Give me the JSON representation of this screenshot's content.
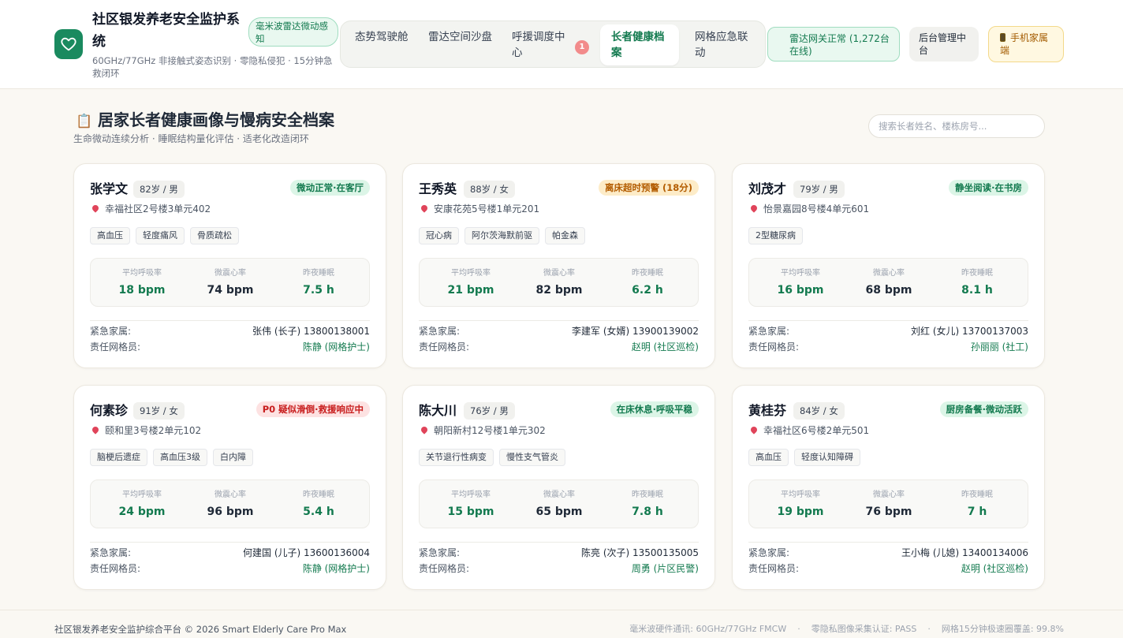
{
  "app": {
    "title": "社区银发养老安全监护系统",
    "subtitle": "60GHz/77GHz 非接触式姿态识别 · 零隐私侵犯 · 15分钟急救闭环",
    "radar_badge": "毫米波雷达微动感知"
  },
  "nav": {
    "tabs": [
      {
        "label": "态势驾驶舱"
      },
      {
        "label": "雷达空间沙盘"
      },
      {
        "label": "呼援调度中心",
        "badge": "1"
      },
      {
        "label": "长者健康档案",
        "active": true
      },
      {
        "label": "网格应急联动"
      }
    ]
  },
  "header_actions": {
    "gateway_status": "雷达网关正常 (1,272台在线)",
    "admin_label": "后台管理中台",
    "mobile_label": "手机家属端",
    "mobile_icon": "phone-icon"
  },
  "page": {
    "title": "居家长者健康画像与慢病安全档案",
    "title_icon": "clipboard-icon",
    "subtitle": "生命微动连续分析 · 睡眠结构量化评估 · 适老化改造闭环",
    "search_placeholder": "搜索长者姓名、楼栋房号..."
  },
  "labels": {
    "respiration": "平均呼吸率",
    "heart_rate": "微震心率",
    "sleep": "昨夜睡眠",
    "family": "紧急家属:",
    "grid_worker": "责任网格员:"
  },
  "colors": {
    "brand": "#1a8a5f",
    "status_green": "#137a4f",
    "status_amber": "#b35c00",
    "status_red": "#c81e1e"
  },
  "elders": [
    {
      "name": "张学文",
      "age_gender": "82岁 / 男",
      "status": "微动正常·在客厅",
      "status_level": "green",
      "address": "幸福社区2号楼3单元402",
      "tags": [
        "高血压",
        "轻度痛风",
        "骨质疏松"
      ],
      "respiration": "18 bpm",
      "heart_rate": "74 bpm",
      "sleep": "7.5 h",
      "family": "张伟 (长子) 13800138001",
      "grid_worker": "陈静 (网格护士)"
    },
    {
      "name": "王秀英",
      "age_gender": "88岁 / 女",
      "status": "离床超时预警 (18分)",
      "status_level": "amber",
      "address": "安康花苑5号楼1单元201",
      "tags": [
        "冠心病",
        "阿尔茨海默前驱",
        "帕金森"
      ],
      "respiration": "21 bpm",
      "heart_rate": "82 bpm",
      "sleep": "6.2 h",
      "family": "李建军 (女婿) 13900139002",
      "grid_worker": "赵明 (社区巡检)"
    },
    {
      "name": "刘茂才",
      "age_gender": "79岁 / 男",
      "status": "静坐阅读·在书房",
      "status_level": "green",
      "address": "怡景嘉园8号楼4单元601",
      "tags": [
        "2型糖尿病"
      ],
      "respiration": "16 bpm",
      "heart_rate": "68 bpm",
      "sleep": "8.1 h",
      "family": "刘红 (女儿) 13700137003",
      "grid_worker": "孙丽丽 (社工)"
    },
    {
      "name": "何素珍",
      "age_gender": "91岁 / 女",
      "status": "P0 疑似滑倒·救援响应中",
      "status_level": "red",
      "address": "颐和里3号楼2单元102",
      "tags": [
        "脑梗后遗症",
        "高血压3级",
        "白内障"
      ],
      "respiration": "24 bpm",
      "heart_rate": "96 bpm",
      "sleep": "5.4 h",
      "family": "何建国 (儿子) 13600136004",
      "grid_worker": "陈静 (网格护士)"
    },
    {
      "name": "陈大川",
      "age_gender": "76岁 / 男",
      "status": "在床休息·呼吸平稳",
      "status_level": "green",
      "address": "朝阳新村12号楼1单元302",
      "tags": [
        "关节退行性病变",
        "慢性支气管炎"
      ],
      "respiration": "15 bpm",
      "heart_rate": "65 bpm",
      "sleep": "7.8 h",
      "family": "陈亮 (次子) 13500135005",
      "grid_worker": "周勇 (片区民警)"
    },
    {
      "name": "黄桂芬",
      "age_gender": "84岁 / 女",
      "status": "厨房备餐·微动活跃",
      "status_level": "green",
      "address": "幸福社区6号楼2单元501",
      "tags": [
        "高血压",
        "轻度认知障碍"
      ],
      "respiration": "19 bpm",
      "heart_rate": "76 bpm",
      "sleep": "7 h",
      "family": "王小梅 (儿媳) 13400134006",
      "grid_worker": "赵明 (社区巡检)"
    }
  ],
  "footer": {
    "copyright": "社区银发养老安全监护综合平台 © 2026 Smart Elderly Care Pro Max",
    "info": [
      "毫米波硬件通讯: 60GHz/77GHz FMCW",
      "零隐私图像采集认证: PASS",
      "网格15分钟极速圈覆盖: 99.8%"
    ],
    "separator": "·"
  }
}
